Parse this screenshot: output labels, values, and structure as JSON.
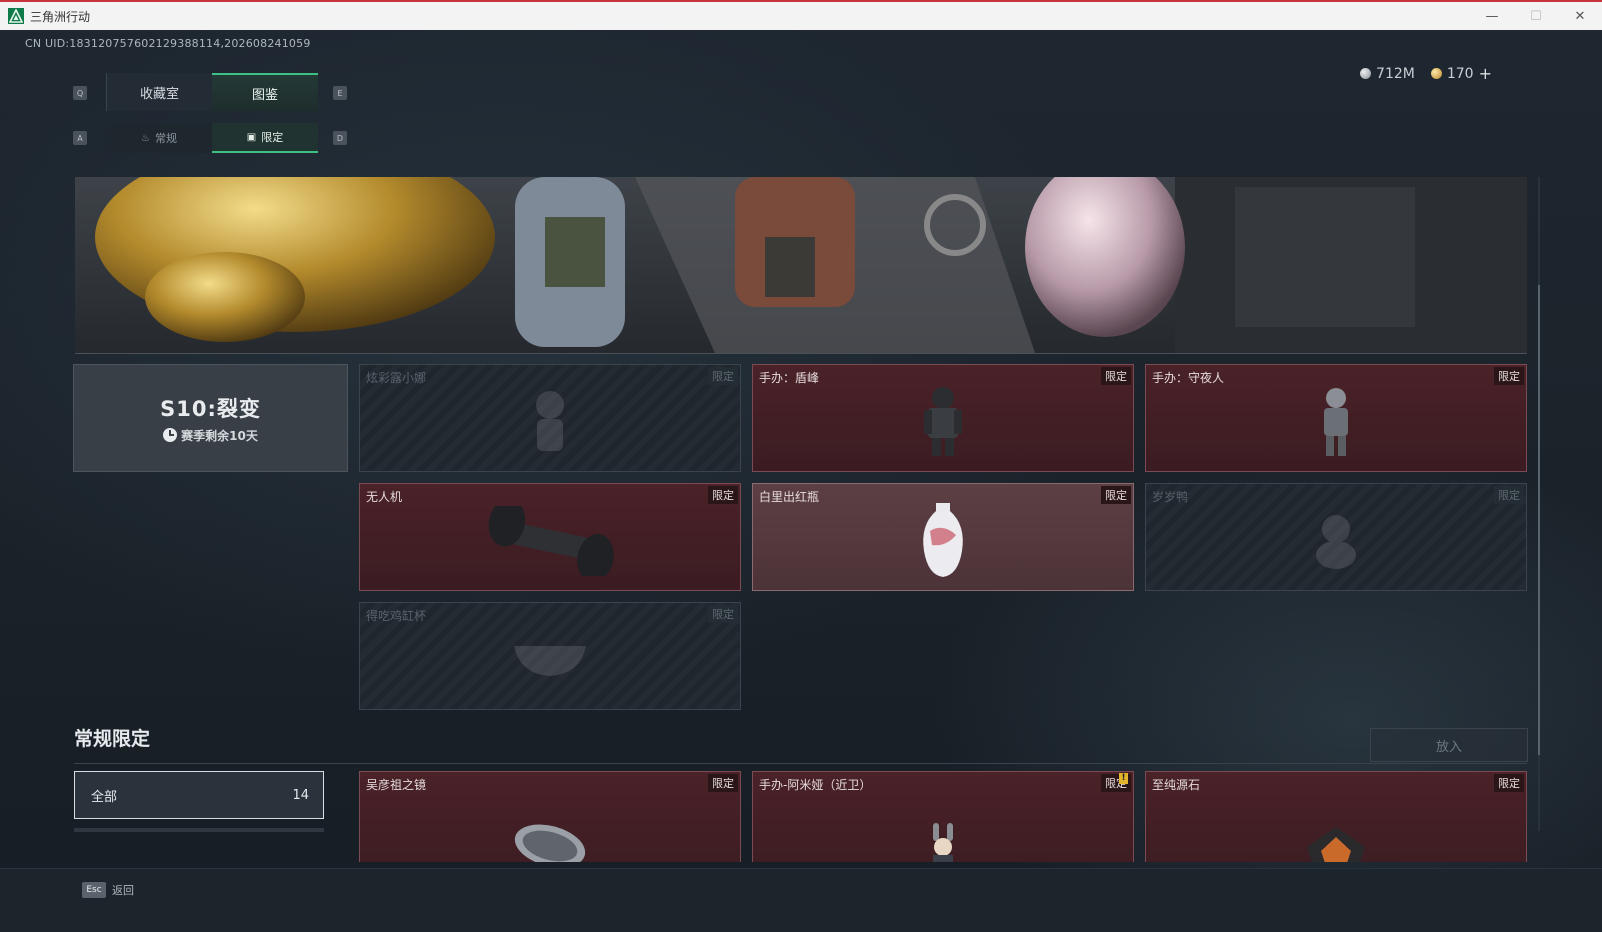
{
  "window": {
    "title": "三角洲行动",
    "minimize": "—",
    "maximize": "☐",
    "close": "✕"
  },
  "uid": "CN UID:18312075760212938811​4,202608241059",
  "currency": {
    "silver": "712M",
    "gold": "170",
    "add": "+"
  },
  "keys": {
    "prev_main": "Q",
    "next_main": "E",
    "prev_sub": "A",
    "next_sub": "D"
  },
  "tabs_main": [
    {
      "label": "收藏室"
    },
    {
      "label": "图鉴"
    }
  ],
  "tabs_sub": [
    {
      "label": "常规"
    },
    {
      "label": "限定"
    }
  ],
  "season": {
    "title": "S10:裂变",
    "remaining": "赛季剩余10天"
  },
  "limited_cards": [
    {
      "name": "炫彩露小娜",
      "tag": "限定"
    },
    {
      "name": "手办：盾峰",
      "tag": "限定"
    },
    {
      "name": "手办：守夜人",
      "tag": "限定"
    },
    {
      "name": "无人机",
      "tag": "限定"
    },
    {
      "name": "白里出红瓶",
      "tag": "限定"
    },
    {
      "name": "岁岁鸭",
      "tag": "限定"
    },
    {
      "name": "得吃鸡缸杯",
      "tag": "限定"
    }
  ],
  "section2": {
    "title": "常规限定",
    "put_button": "放入",
    "filter_all": {
      "label": "全部",
      "count": "14"
    },
    "cards": [
      {
        "name": "吴彦祖之镜",
        "tag": "限定"
      },
      {
        "name": "手办-阿米娅（近卫）",
        "tag": "限定",
        "warn": "!"
      },
      {
        "name": "至纯源石",
        "tag": "限定"
      }
    ]
  },
  "footer": {
    "esc_key": "Esc",
    "back": "返回"
  }
}
